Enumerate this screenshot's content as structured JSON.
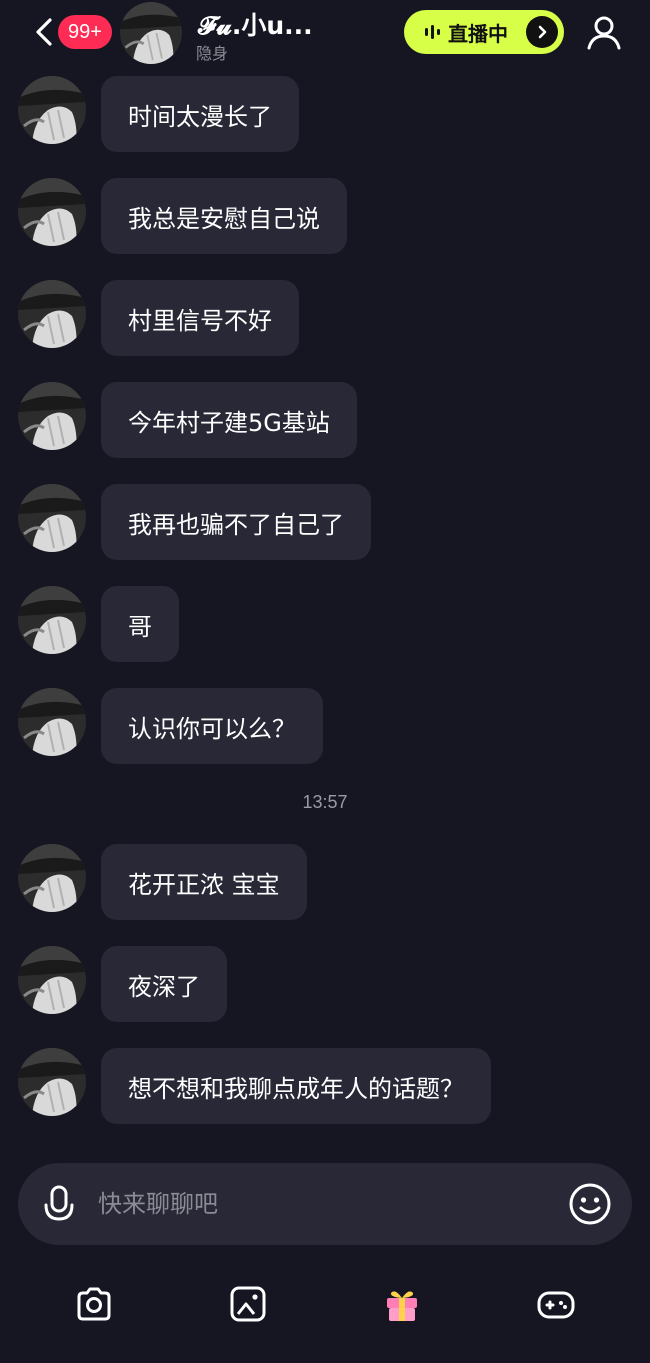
{
  "header": {
    "unread_count": "99+",
    "contact_name": "𝓕𝓾.小u...",
    "contact_status": "隐身",
    "live_label": "直播中",
    "icons": {
      "back": "chevron-left-icon",
      "live_wave": "sound-wave-icon",
      "live_arrow": "chevron-right-icon",
      "profile": "user-icon"
    }
  },
  "messages": [
    {
      "text": "时间太漫长了"
    },
    {
      "text": "我总是安慰自己说"
    },
    {
      "text": "村里信号不好"
    },
    {
      "text": "今年村子建5G基站"
    },
    {
      "text": "我再也骗不了自己了"
    },
    {
      "text": "哥"
    },
    {
      "text": "认识你可以么？"
    },
    {
      "text": "花开正浓 宝宝"
    },
    {
      "text": "夜深了"
    },
    {
      "text": "想不想和我聊点成年人的话题？"
    }
  ],
  "timestamp": "13:57",
  "composer": {
    "placeholder": "快来聊聊吧",
    "icons": {
      "mic": "microphone-icon",
      "emoji": "smiley-icon"
    }
  },
  "toolbar": {
    "icons": [
      "camera-icon",
      "image-icon",
      "gift-icon",
      "game-controller-icon"
    ]
  },
  "colors": {
    "background": "#161623",
    "bubble": "#282837",
    "accent_live": "#d8ff47",
    "badge": "#fe2c55"
  }
}
